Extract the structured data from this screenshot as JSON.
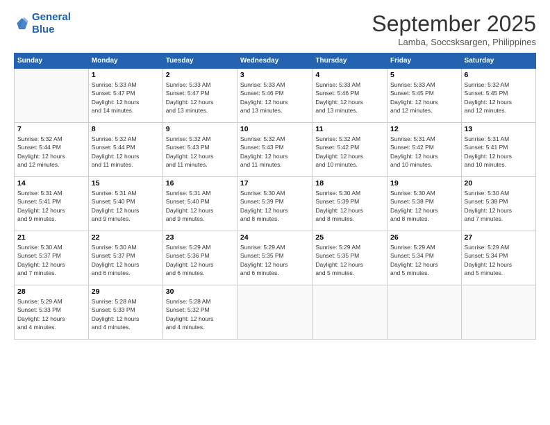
{
  "logo": {
    "line1": "General",
    "line2": "Blue"
  },
  "title": "September 2025",
  "subtitle": "Lamba, Soccsksargen, Philippines",
  "days_of_week": [
    "Sunday",
    "Monday",
    "Tuesday",
    "Wednesday",
    "Thursday",
    "Friday",
    "Saturday"
  ],
  "weeks": [
    [
      {
        "day": "",
        "info": ""
      },
      {
        "day": "1",
        "info": "Sunrise: 5:33 AM\nSunset: 5:47 PM\nDaylight: 12 hours\nand 14 minutes."
      },
      {
        "day": "2",
        "info": "Sunrise: 5:33 AM\nSunset: 5:47 PM\nDaylight: 12 hours\nand 13 minutes."
      },
      {
        "day": "3",
        "info": "Sunrise: 5:33 AM\nSunset: 5:46 PM\nDaylight: 12 hours\nand 13 minutes."
      },
      {
        "day": "4",
        "info": "Sunrise: 5:33 AM\nSunset: 5:46 PM\nDaylight: 12 hours\nand 13 minutes."
      },
      {
        "day": "5",
        "info": "Sunrise: 5:33 AM\nSunset: 5:45 PM\nDaylight: 12 hours\nand 12 minutes."
      },
      {
        "day": "6",
        "info": "Sunrise: 5:32 AM\nSunset: 5:45 PM\nDaylight: 12 hours\nand 12 minutes."
      }
    ],
    [
      {
        "day": "7",
        "info": "Sunrise: 5:32 AM\nSunset: 5:44 PM\nDaylight: 12 hours\nand 12 minutes."
      },
      {
        "day": "8",
        "info": "Sunrise: 5:32 AM\nSunset: 5:44 PM\nDaylight: 12 hours\nand 11 minutes."
      },
      {
        "day": "9",
        "info": "Sunrise: 5:32 AM\nSunset: 5:43 PM\nDaylight: 12 hours\nand 11 minutes."
      },
      {
        "day": "10",
        "info": "Sunrise: 5:32 AM\nSunset: 5:43 PM\nDaylight: 12 hours\nand 11 minutes."
      },
      {
        "day": "11",
        "info": "Sunrise: 5:32 AM\nSunset: 5:42 PM\nDaylight: 12 hours\nand 10 minutes."
      },
      {
        "day": "12",
        "info": "Sunrise: 5:31 AM\nSunset: 5:42 PM\nDaylight: 12 hours\nand 10 minutes."
      },
      {
        "day": "13",
        "info": "Sunrise: 5:31 AM\nSunset: 5:41 PM\nDaylight: 12 hours\nand 10 minutes."
      }
    ],
    [
      {
        "day": "14",
        "info": "Sunrise: 5:31 AM\nSunset: 5:41 PM\nDaylight: 12 hours\nand 9 minutes."
      },
      {
        "day": "15",
        "info": "Sunrise: 5:31 AM\nSunset: 5:40 PM\nDaylight: 12 hours\nand 9 minutes."
      },
      {
        "day": "16",
        "info": "Sunrise: 5:31 AM\nSunset: 5:40 PM\nDaylight: 12 hours\nand 9 minutes."
      },
      {
        "day": "17",
        "info": "Sunrise: 5:30 AM\nSunset: 5:39 PM\nDaylight: 12 hours\nand 8 minutes."
      },
      {
        "day": "18",
        "info": "Sunrise: 5:30 AM\nSunset: 5:39 PM\nDaylight: 12 hours\nand 8 minutes."
      },
      {
        "day": "19",
        "info": "Sunrise: 5:30 AM\nSunset: 5:38 PM\nDaylight: 12 hours\nand 8 minutes."
      },
      {
        "day": "20",
        "info": "Sunrise: 5:30 AM\nSunset: 5:38 PM\nDaylight: 12 hours\nand 7 minutes."
      }
    ],
    [
      {
        "day": "21",
        "info": "Sunrise: 5:30 AM\nSunset: 5:37 PM\nDaylight: 12 hours\nand 7 minutes."
      },
      {
        "day": "22",
        "info": "Sunrise: 5:30 AM\nSunset: 5:37 PM\nDaylight: 12 hours\nand 6 minutes."
      },
      {
        "day": "23",
        "info": "Sunrise: 5:29 AM\nSunset: 5:36 PM\nDaylight: 12 hours\nand 6 minutes."
      },
      {
        "day": "24",
        "info": "Sunrise: 5:29 AM\nSunset: 5:35 PM\nDaylight: 12 hours\nand 6 minutes."
      },
      {
        "day": "25",
        "info": "Sunrise: 5:29 AM\nSunset: 5:35 PM\nDaylight: 12 hours\nand 5 minutes."
      },
      {
        "day": "26",
        "info": "Sunrise: 5:29 AM\nSunset: 5:34 PM\nDaylight: 12 hours\nand 5 minutes."
      },
      {
        "day": "27",
        "info": "Sunrise: 5:29 AM\nSunset: 5:34 PM\nDaylight: 12 hours\nand 5 minutes."
      }
    ],
    [
      {
        "day": "28",
        "info": "Sunrise: 5:29 AM\nSunset: 5:33 PM\nDaylight: 12 hours\nand 4 minutes."
      },
      {
        "day": "29",
        "info": "Sunrise: 5:28 AM\nSunset: 5:33 PM\nDaylight: 12 hours\nand 4 minutes."
      },
      {
        "day": "30",
        "info": "Sunrise: 5:28 AM\nSunset: 5:32 PM\nDaylight: 12 hours\nand 4 minutes."
      },
      {
        "day": "",
        "info": ""
      },
      {
        "day": "",
        "info": ""
      },
      {
        "day": "",
        "info": ""
      },
      {
        "day": "",
        "info": ""
      }
    ]
  ]
}
